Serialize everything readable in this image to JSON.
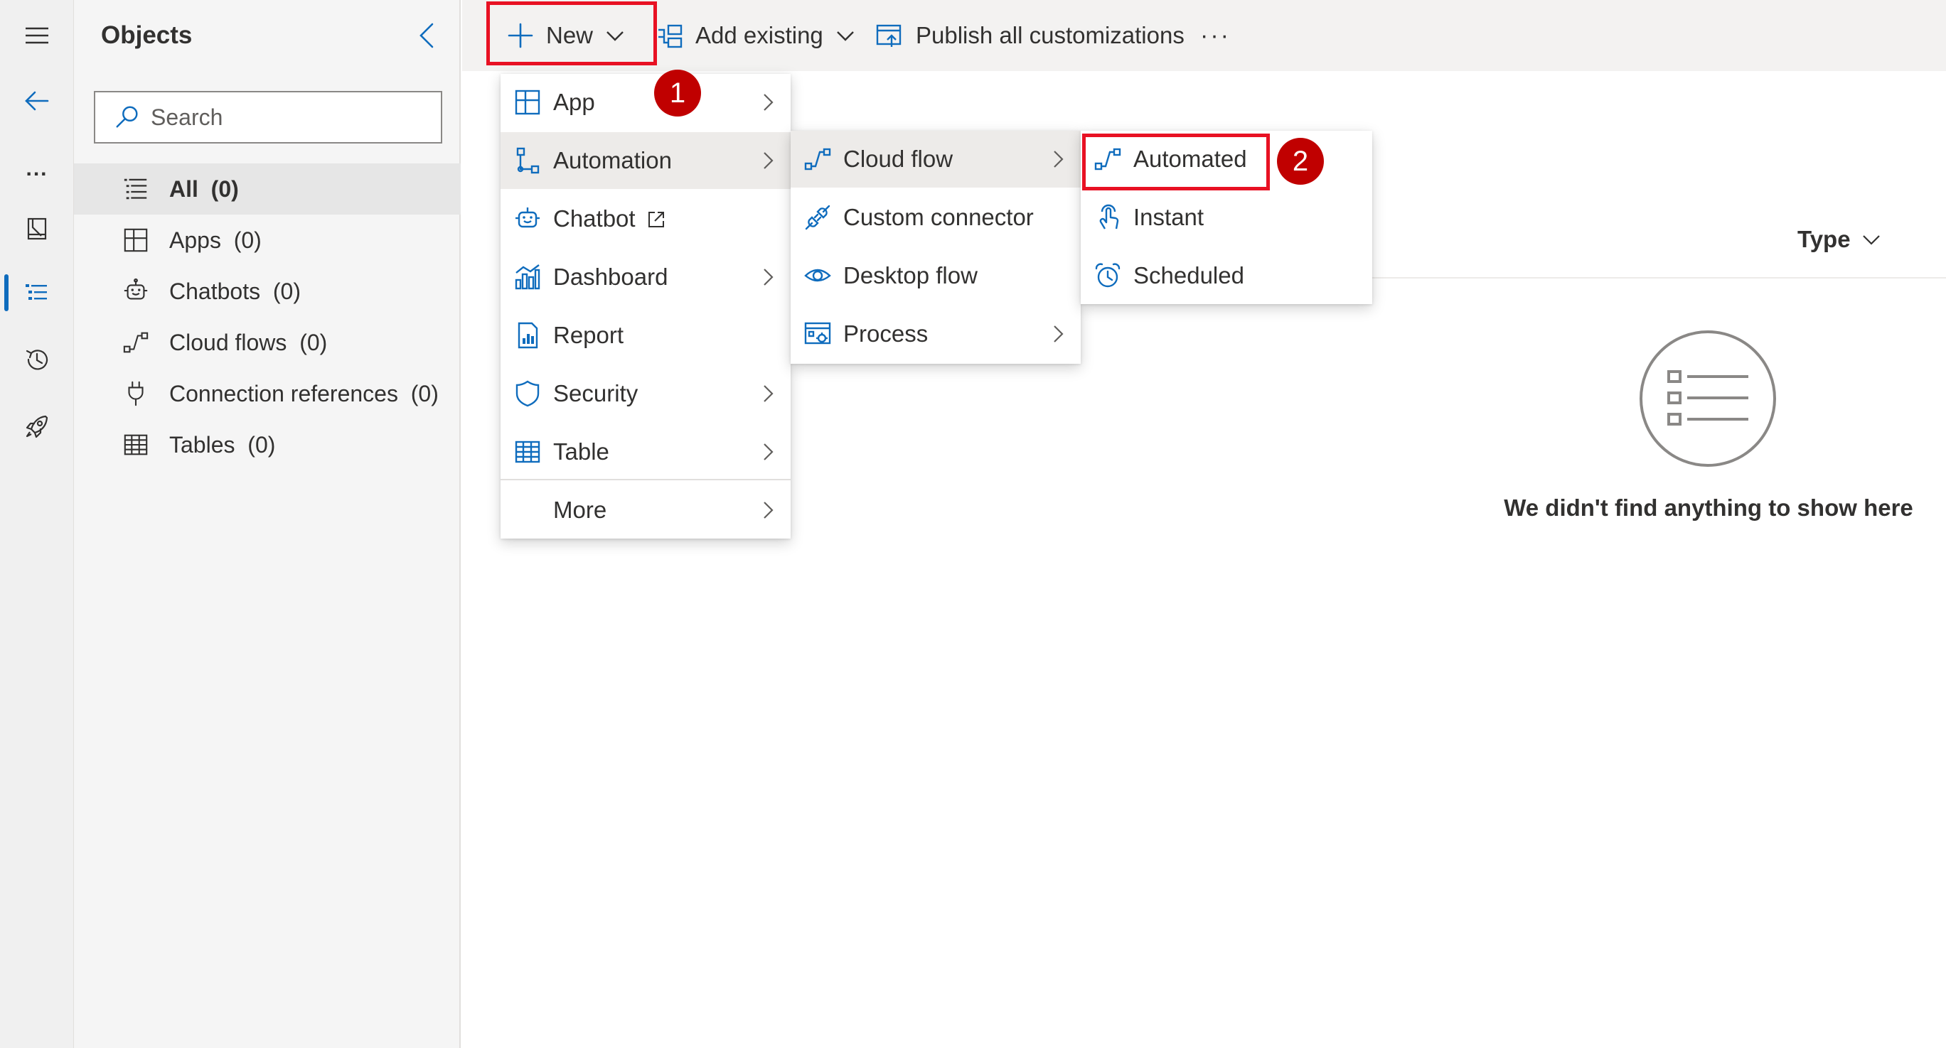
{
  "rail": {
    "items": [
      {
        "icon": "hamburger-menu-icon"
      },
      {
        "icon": "back-arrow-icon"
      },
      {
        "icon": "more-icon",
        "label": "..."
      },
      {
        "icon": "book-icon"
      },
      {
        "icon": "objects-list-icon",
        "active": true
      },
      {
        "icon": "history-icon"
      },
      {
        "icon": "rocket-icon"
      }
    ]
  },
  "objects_pane": {
    "title": "Objects",
    "search_placeholder": "Search",
    "items": [
      {
        "label": "All",
        "count": "(0)",
        "icon": "list-icon",
        "selected": true
      },
      {
        "label": "Apps",
        "count": "(0)",
        "icon": "apps-icon"
      },
      {
        "label": "Chatbots",
        "count": "(0)",
        "icon": "chatbot-icon"
      },
      {
        "label": "Cloud flows",
        "count": "(0)",
        "icon": "cloud-flow-icon"
      },
      {
        "label": "Connection references",
        "count": "(0)",
        "icon": "plug-icon"
      },
      {
        "label": "Tables",
        "count": "(0)",
        "icon": "table-icon"
      }
    ]
  },
  "command_bar": {
    "new_label": "New",
    "add_existing_label": "Add existing",
    "publish_label": "Publish all customizations",
    "more_label": "···"
  },
  "new_menu": {
    "items": [
      {
        "label": "App",
        "icon": "app-icon",
        "submenu": true
      },
      {
        "label": "Automation",
        "icon": "automation-icon",
        "submenu": true,
        "selected": true
      },
      {
        "label": "Chatbot",
        "icon": "chatbot-icon",
        "external": true
      },
      {
        "label": "Dashboard",
        "icon": "dashboard-icon",
        "submenu": true
      },
      {
        "label": "Report",
        "icon": "report-icon"
      },
      {
        "label": "Security",
        "icon": "shield-icon",
        "submenu": true
      },
      {
        "label": "Table",
        "icon": "table-icon",
        "submenu": true
      },
      {
        "label": "More",
        "submenu": true
      }
    ]
  },
  "automation_menu": {
    "items": [
      {
        "label": "Cloud flow",
        "icon": "cloud-flow-icon",
        "submenu": true,
        "selected": true
      },
      {
        "label": "Custom connector",
        "icon": "custom-connector-icon"
      },
      {
        "label": "Desktop flow",
        "icon": "eye-icon"
      },
      {
        "label": "Process",
        "icon": "process-icon",
        "submenu": true
      }
    ]
  },
  "cloud_flow_menu": {
    "items": [
      {
        "label": "Automated",
        "icon": "cloud-flow-icon"
      },
      {
        "label": "Instant",
        "icon": "touch-icon"
      },
      {
        "label": "Scheduled",
        "icon": "alarm-clock-icon"
      }
    ]
  },
  "callouts": [
    {
      "number": "1"
    },
    {
      "number": "2"
    }
  ],
  "main": {
    "type_column_label": "Type",
    "empty_message": "We didn't find anything to show here"
  },
  "colors": {
    "accent_blue": "#0f6cbd",
    "highlight_red": "#e81123",
    "badge_red": "#c00000"
  }
}
